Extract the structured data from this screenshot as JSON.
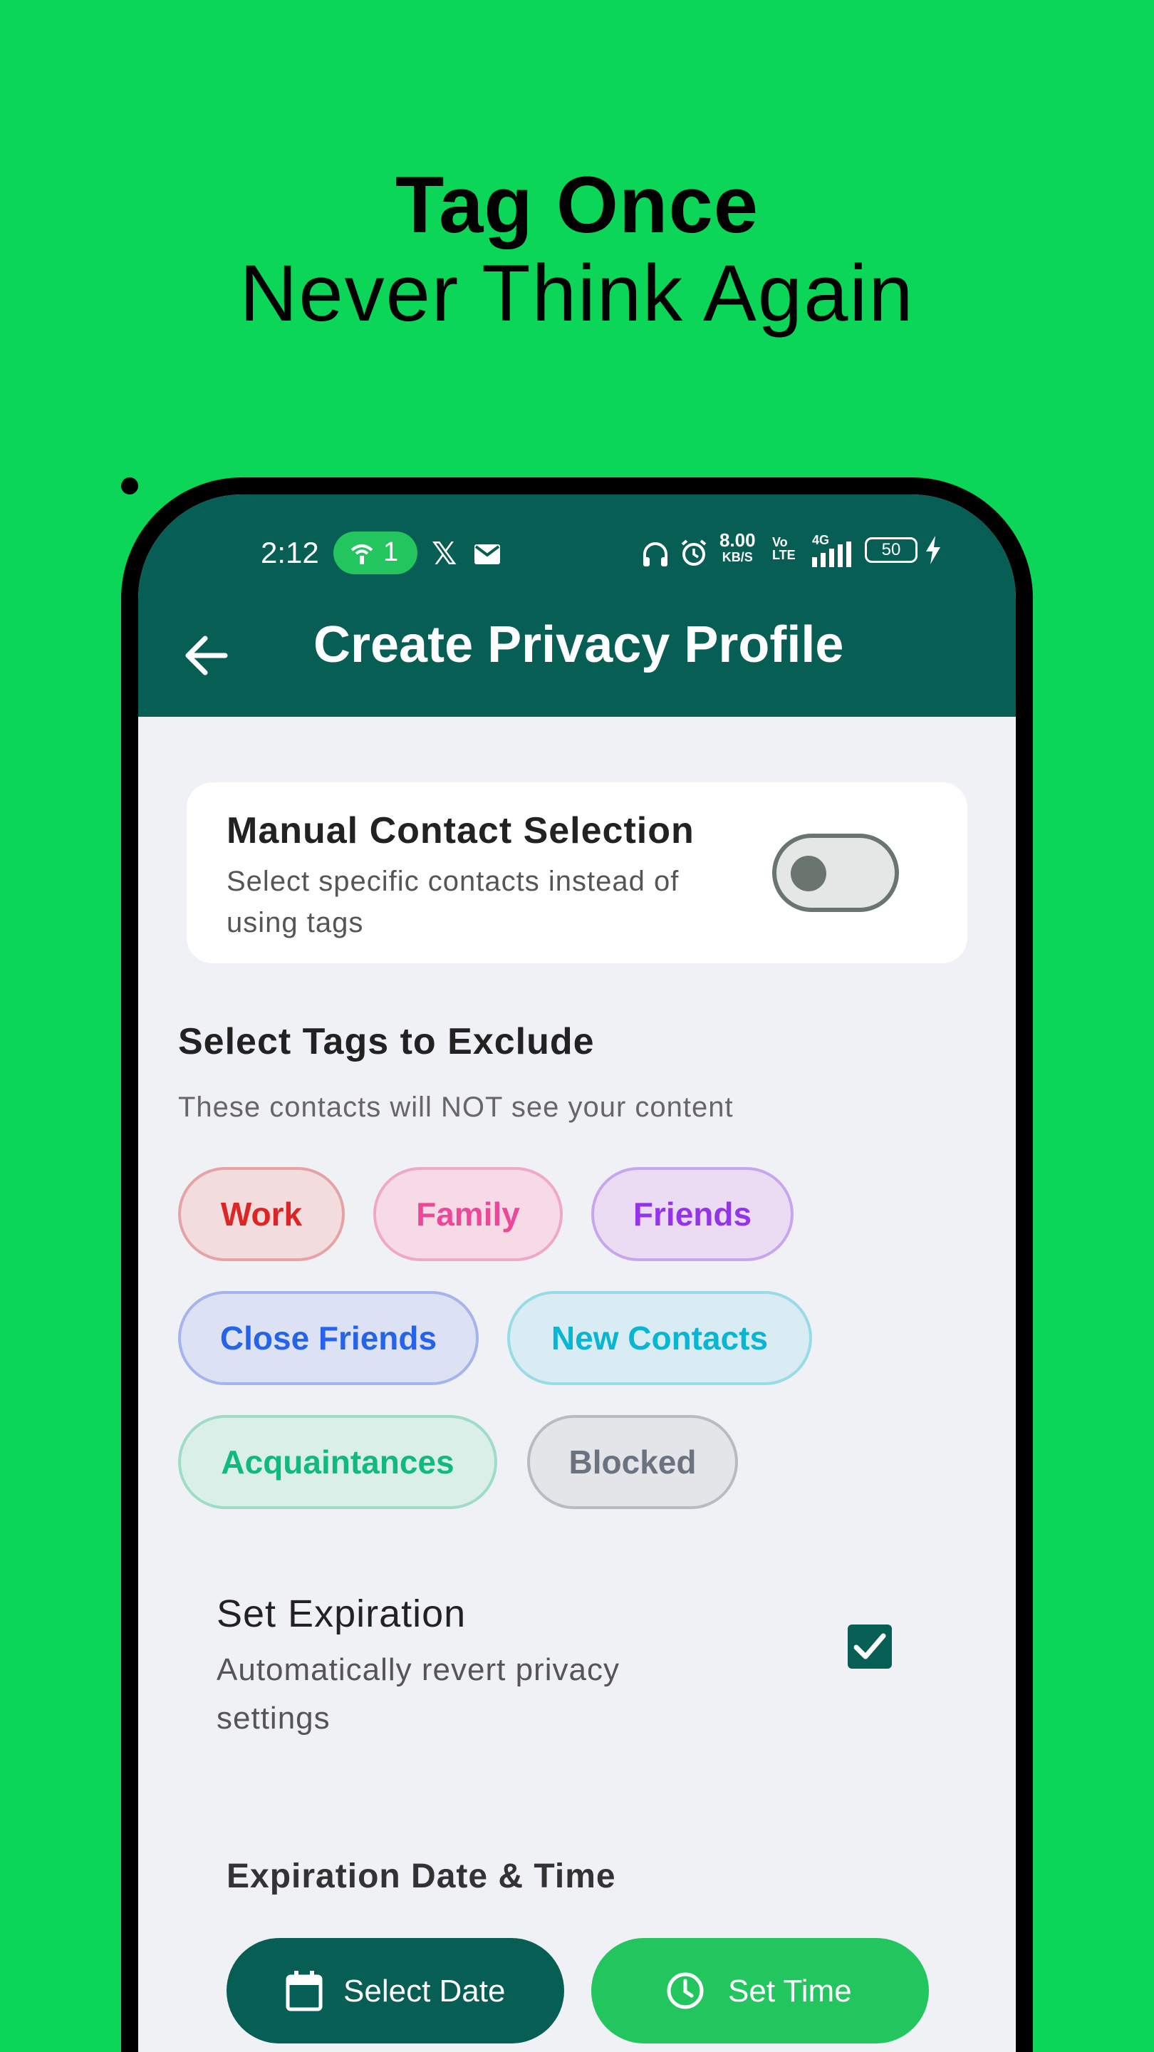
{
  "headline": {
    "line1": "Tag Once",
    "line2": "Never Think Again"
  },
  "status_bar": {
    "time": "2:12",
    "hotspot_count": "1",
    "x_glyph": "𝕏",
    "net_speed": "8.00",
    "net_unit": "KB/S",
    "volte_top": "Vo",
    "volte_bottom": "LTE",
    "network": "4G",
    "battery": "50"
  },
  "appbar": {
    "title": "Create Privacy Profile"
  },
  "manual_selection": {
    "title": "Manual Contact Selection",
    "subtitle": "Select specific contacts instead of using tags",
    "enabled": false
  },
  "tags_section": {
    "title": "Select Tags to Exclude",
    "subtitle": "These contacts will NOT see your content",
    "tags": [
      {
        "label": "Work",
        "color": "#dc2626"
      },
      {
        "label": "Family",
        "color": "#ec4899"
      },
      {
        "label": "Friends",
        "color": "#9333ea"
      },
      {
        "label": "Close Friends",
        "color": "#2563eb"
      },
      {
        "label": "New Contacts",
        "color": "#06b6d4"
      },
      {
        "label": "Acquaintances",
        "color": "#10b981"
      },
      {
        "label": "Blocked",
        "color": "#6b7280"
      }
    ]
  },
  "expiration": {
    "title": "Set Expiration",
    "subtitle": "Automatically revert privacy settings",
    "checked": true
  },
  "date_time": {
    "title": "Expiration Date & Time",
    "select_date_label": "Select Date",
    "set_time_label": "Set Time"
  },
  "colors": {
    "background": "#0bd657",
    "appbar": "#075e54",
    "accent_green": "#22c55e"
  }
}
